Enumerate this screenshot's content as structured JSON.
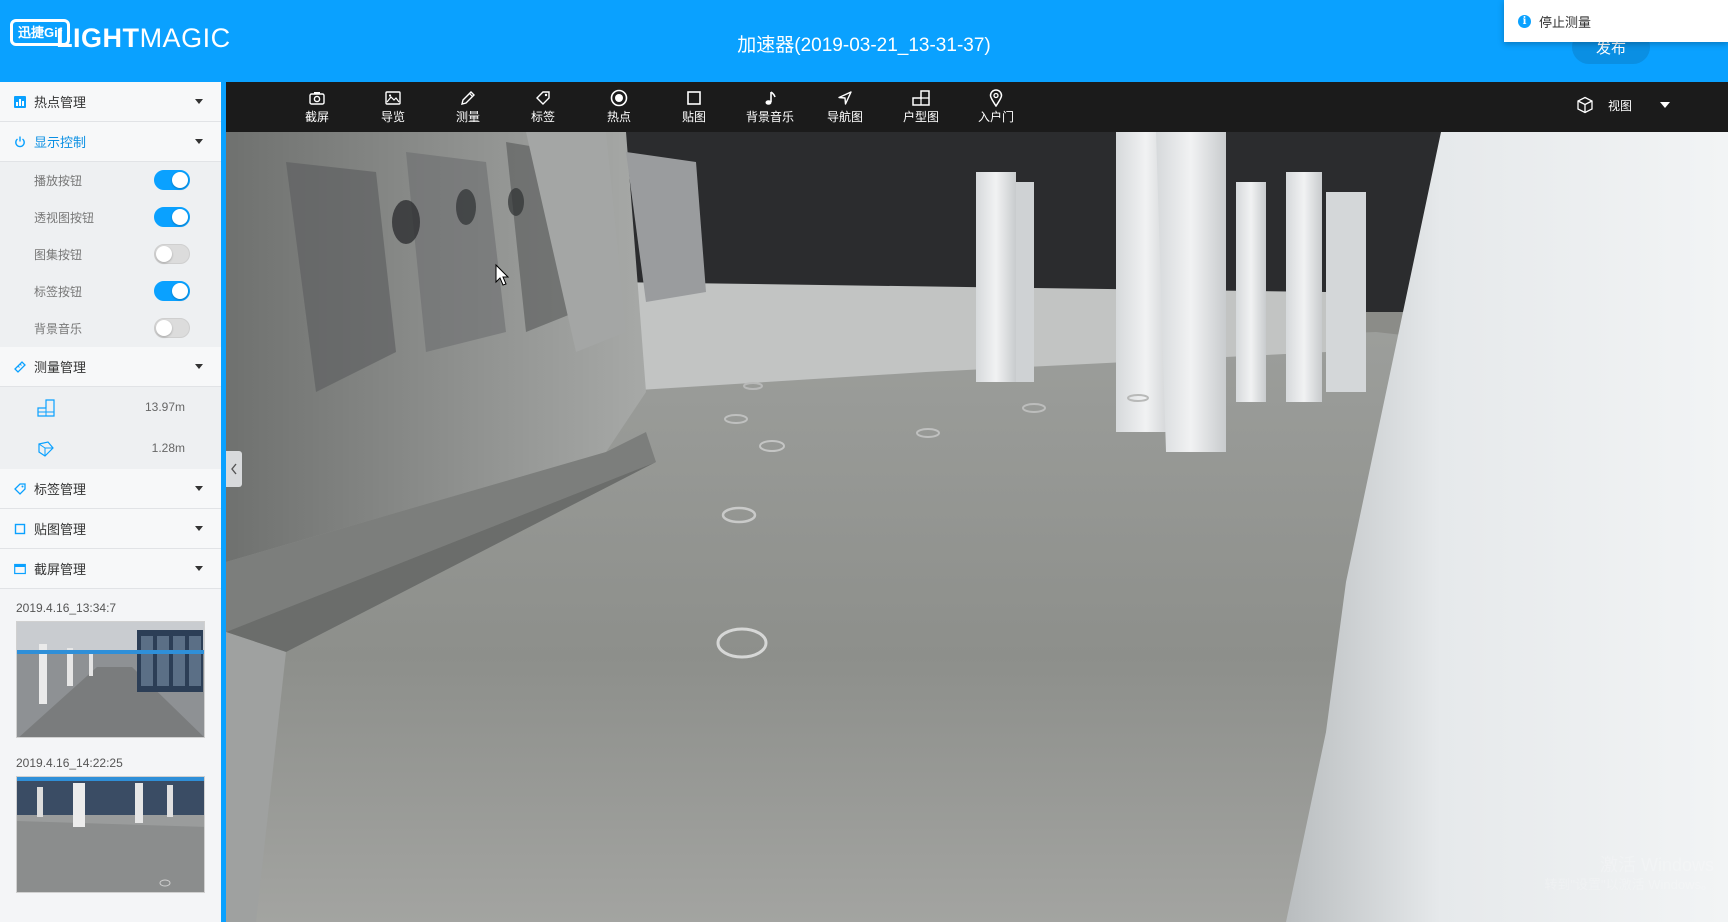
{
  "header": {
    "logo_badge": "迅捷Gif",
    "logo_bold": "LIGHT",
    "logo_light": "MAGIC",
    "title": "加速器(2019-03-21_13-31-37)",
    "publish_label": "发布"
  },
  "notification": {
    "text": "停止测量"
  },
  "sidebar": {
    "hotspot_mgmt": "热点管理",
    "display_ctrl": "显示控制",
    "toggles": [
      {
        "label": "播放按钮",
        "on": true
      },
      {
        "label": "透视图按钮",
        "on": true
      },
      {
        "label": "图集按钮",
        "on": false
      },
      {
        "label": "标签按钮",
        "on": true
      },
      {
        "label": "背景音乐",
        "on": false
      }
    ],
    "measure_mgmt": "测量管理",
    "measures": [
      {
        "icon": "floor-area-icon",
        "value": "13.97m"
      },
      {
        "icon": "height-measure-icon",
        "value": "1.28m"
      }
    ],
    "tag_mgmt": "标签管理",
    "sticker_mgmt": "贴图管理",
    "screenshot_mgmt": "截屏管理",
    "screenshots": [
      {
        "time": "2019.4.16_13:34:7"
      },
      {
        "time": "2019.4.16_14:22:25"
      }
    ]
  },
  "toolbar": {
    "tools": [
      {
        "label": "截屏",
        "icon": "camera-icon"
      },
      {
        "label": "导览",
        "icon": "image-icon"
      },
      {
        "label": "测量",
        "icon": "pencil-icon"
      },
      {
        "label": "标签",
        "icon": "tag-icon"
      },
      {
        "label": "热点",
        "icon": "hotspot-icon"
      },
      {
        "label": "贴图",
        "icon": "square-icon"
      },
      {
        "label": "背景音乐",
        "icon": "music-icon"
      },
      {
        "label": "导航图",
        "icon": "navigation-icon"
      },
      {
        "label": "户型图",
        "icon": "floorplan-icon"
      },
      {
        "label": "入户门",
        "icon": "location-pin-icon"
      }
    ],
    "view_label": "视图"
  },
  "viewport": {
    "watermark_line1": "激活 Windows",
    "watermark_line2": "转到\"设置\"以激活 Windows。"
  },
  "colors": {
    "accent": "#0aa1ff",
    "toolbar_bg": "#1b1b1b",
    "sidebar_bg": "#f4f5f7"
  }
}
